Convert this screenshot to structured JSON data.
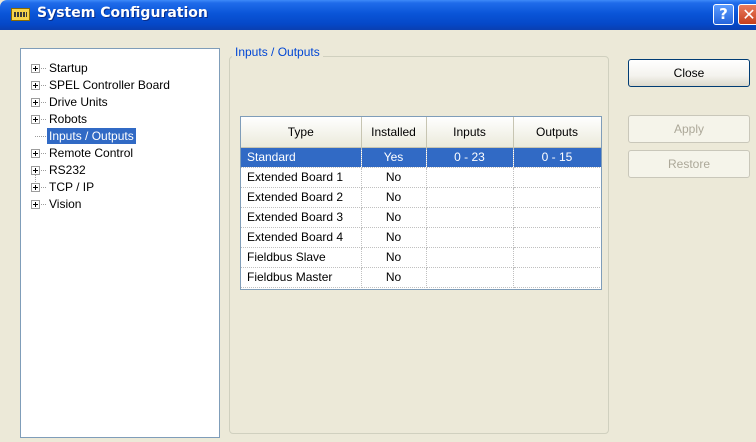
{
  "window": {
    "title": "System Configuration",
    "help_label": "?",
    "close_label": "✕"
  },
  "tree": {
    "items": [
      {
        "label": "Startup",
        "expandable": true
      },
      {
        "label": "SPEL Controller Board",
        "expandable": true
      },
      {
        "label": "Drive Units",
        "expandable": true
      },
      {
        "label": "Robots",
        "expandable": true
      },
      {
        "label": "Inputs / Outputs",
        "expandable": false,
        "selected": true
      },
      {
        "label": "Remote Control",
        "expandable": true
      },
      {
        "label": "RS232",
        "expandable": true
      },
      {
        "label": "TCP / IP",
        "expandable": true
      },
      {
        "label": "Vision",
        "expandable": true
      }
    ]
  },
  "group": {
    "title": "Inputs / Outputs"
  },
  "table": {
    "columns": [
      "Type",
      "Installed",
      "Inputs",
      "Outputs"
    ],
    "rows": [
      {
        "type": "Standard",
        "installed": "Yes",
        "inputs": "0 - 23",
        "outputs": "0 - 15",
        "selected": true
      },
      {
        "type": "Extended Board 1",
        "installed": "No",
        "inputs": "",
        "outputs": ""
      },
      {
        "type": "Extended Board 2",
        "installed": "No",
        "inputs": "",
        "outputs": ""
      },
      {
        "type": "Extended Board 3",
        "installed": "No",
        "inputs": "",
        "outputs": ""
      },
      {
        "type": "Extended Board 4",
        "installed": "No",
        "inputs": "",
        "outputs": ""
      },
      {
        "type": "Fieldbus Slave",
        "installed": "No",
        "inputs": "",
        "outputs": ""
      },
      {
        "type": "Fieldbus Master",
        "installed": "No",
        "inputs": "",
        "outputs": ""
      }
    ]
  },
  "buttons": {
    "close": {
      "label": "Close",
      "enabled": true
    },
    "apply": {
      "label": "Apply",
      "enabled": false
    },
    "restore": {
      "label": "Restore",
      "enabled": false
    }
  },
  "colors": {
    "selection": "#316ac5",
    "titlebar": "#0a55d8",
    "group_title": "#0046d5"
  }
}
